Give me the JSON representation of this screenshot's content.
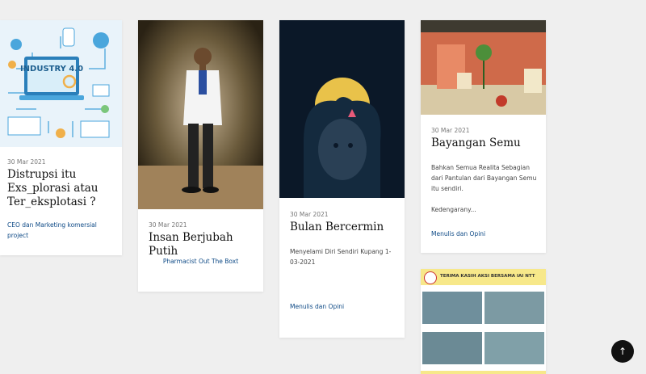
{
  "posts": [
    {
      "date": "30 Mar 2021",
      "title": "Distrupsi itu\nExs_plorasi atau\nTer_eksplotasi ?",
      "excerpt": "",
      "category": "CEO dan Marketing komersial\nproject",
      "image": "industry-4-0-illustration",
      "image_text": "INDUSTRY 4.0"
    },
    {
      "date": "30 Mar 2021",
      "title": "Insan Berjubah Putih",
      "excerpt": "",
      "category": "Pharmacist Out The Boxt",
      "image": "man-white-coat-photo"
    },
    {
      "date": "30 Mar 2021",
      "title": "Bulan Bercermin",
      "excerpt": "Menyelami Diri Sendiri Kupang  1-\n03-2021",
      "category": "Menulis dan Opini",
      "image": "moon-silhouette-photo"
    },
    {
      "date": "30 Mar 2021",
      "title": "Bayangan Semu",
      "excerpt": "Bahkan Semua  Realita Sebagian\ndari Pantulan dari Bayangan Semu\nitu sendiri.\n\nKedengarany...",
      "category": "Menulis dan Opini",
      "image": "desk-lamp-photo"
    }
  ],
  "banner": {
    "text": "TERIMA KASIH AKSI BERSAMA IAI NTT",
    "image": "donation-collage"
  },
  "scroll_top_icon": "arrow-up-icon"
}
